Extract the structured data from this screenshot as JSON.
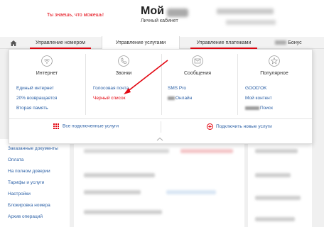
{
  "header": {
    "tagline": "Ты знаешь, что можешь!",
    "brand_title": "Мой",
    "brand_subtitle": "Личный кабинет"
  },
  "nav": {
    "tabs": [
      {
        "label": "Управление номером"
      },
      {
        "label": "Управление услугами"
      },
      {
        "label": "Управление платежами"
      },
      {
        "label": "Бонус"
      }
    ]
  },
  "menu": {
    "columns": [
      {
        "icon": "wifi-icon",
        "title": "Интернет",
        "links": [
          "Единый интернет",
          "20% возвращается",
          "Вторая память"
        ]
      },
      {
        "icon": "phone-icon",
        "title": "Звонки",
        "links": [
          "Голосовая почта",
          "Черный список"
        ]
      },
      {
        "icon": "message-icon",
        "title": "Сообщения",
        "links": [
          "SMS Pro",
          "Онлайн"
        ]
      },
      {
        "icon": "star-icon",
        "title": "Популярное",
        "links": [
          "GOOD'OK",
          "Мой контент",
          "Поиск"
        ]
      }
    ],
    "footer_left": "Все подключенные услуги",
    "footer_right": "Подключить новые услуги"
  },
  "sidebar": {
    "items": [
      "Заказанные документы",
      "Оплата",
      "На полном доверии",
      "Тарифы и услуги",
      "Настройки",
      "Блокировка номера",
      "Архив операций"
    ]
  },
  "colors": {
    "accent": "#e30611",
    "link": "#2a5fa5"
  }
}
